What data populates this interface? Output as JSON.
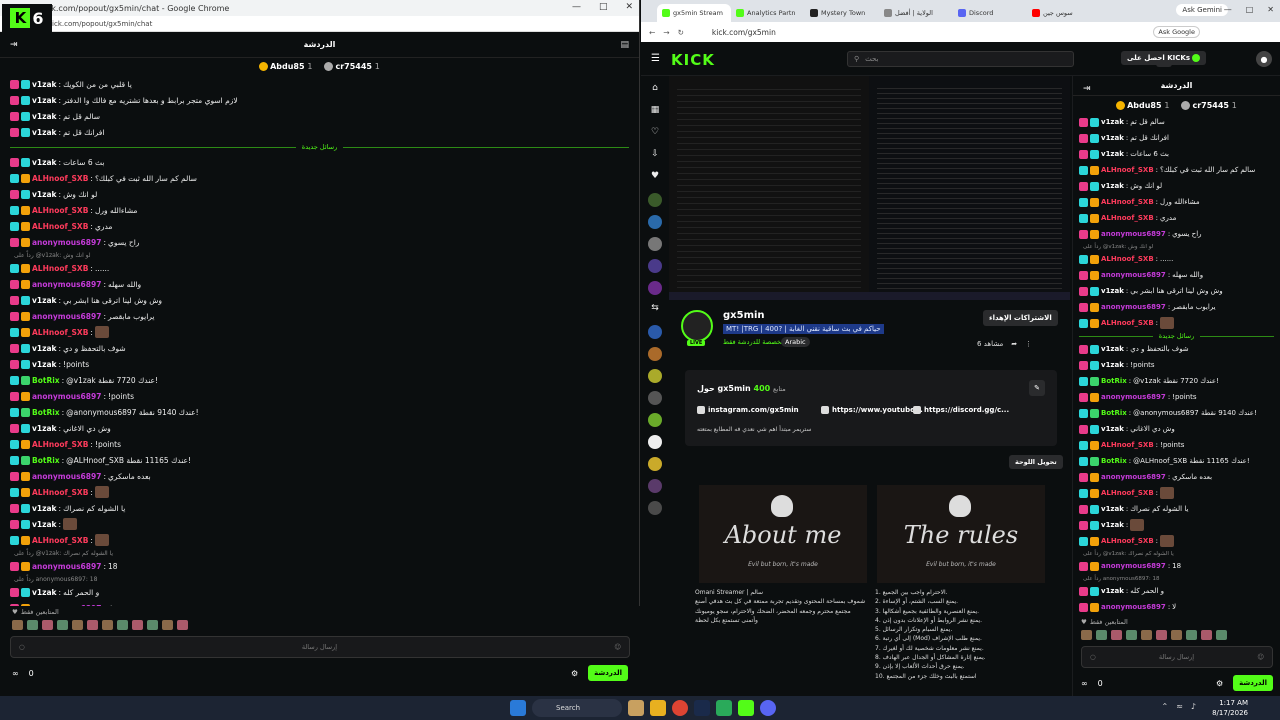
{
  "left_window": {
    "title": "kick.com/popout/gx5min/chat - Google Chrome",
    "address": "kick.com/popout/gx5min/chat",
    "logo_text": "6",
    "chat_title": "الدردشة",
    "gifters": [
      {
        "name": "Abdu85",
        "count": "1"
      },
      {
        "name": "cr75445",
        "count": "1"
      }
    ],
    "separator_label": "رسائل جديدة",
    "messages_before": [
      {
        "user": "v1zak",
        "color": "w",
        "badges": [
          "pk",
          "cy"
        ],
        "text": "يا قلبي من من الكويك"
      },
      {
        "user": "v1zak",
        "color": "w",
        "badges": [
          "pk",
          "cy"
        ],
        "text": "لازم اسوي متجر برابط و بعدها تشتريه مع فالك وا الدفتر"
      },
      {
        "user": "v1zak",
        "color": "w",
        "badges": [
          "pk",
          "cy"
        ],
        "text": "سالم قل تم"
      },
      {
        "user": "v1zak",
        "color": "w",
        "badges": [
          "pk",
          "cy"
        ],
        "text": "افرانك قل تم"
      }
    ],
    "messages_after": [
      {
        "user": "v1zak",
        "color": "w",
        "badges": [
          "pk",
          "cy"
        ],
        "text": "بث 6 ساعات"
      },
      {
        "user": "ALHnoof_SXB",
        "color": "r",
        "badges": [
          "cy",
          "gd"
        ],
        "text": "سالم كم سار الله ثبت في كبلك؟"
      },
      {
        "user": "v1zak",
        "color": "w",
        "badges": [
          "pk",
          "cy"
        ],
        "text": "لو انك وش"
      },
      {
        "user": "ALHnoof_SXB",
        "color": "r",
        "badges": [
          "cy",
          "gd"
        ],
        "text": "مشاءالله ورل"
      },
      {
        "user": "ALHnoof_SXB",
        "color": "r",
        "badges": [
          "cy",
          "gd"
        ],
        "text": "مدري"
      },
      {
        "user": "anonymous6897",
        "color": "m",
        "badges": [
          "pk",
          "gd"
        ],
        "text": "راح يسوي"
      },
      {
        "reply": "رداً على @v1zak: لو انك وش",
        "user": "ALHnoof_SXB",
        "color": "r",
        "badges": [
          "cy",
          "gd"
        ],
        "text": "......"
      },
      {
        "user": "anonymous6897",
        "color": "m",
        "badges": [
          "pk",
          "gd"
        ],
        "text": "والله سهله"
      },
      {
        "user": "v1zak",
        "color": "w",
        "badges": [
          "pk",
          "cy"
        ],
        "text": "وش وش لينا اترقى هنا ابشر بي"
      },
      {
        "user": "anonymous6897",
        "color": "m",
        "badges": [
          "pk",
          "gd"
        ],
        "text": "يرايوب مابقصر"
      },
      {
        "user": "ALHnoof_SXB",
        "color": "r",
        "badges": [
          "cy",
          "gd"
        ],
        "text": "",
        "emoji": true
      },
      {
        "user": "v1zak",
        "color": "w",
        "badges": [
          "pk",
          "cy"
        ],
        "text": "شوف بالتحفظ و دي"
      },
      {
        "user": "v1zak",
        "color": "w",
        "badges": [
          "pk",
          "cy"
        ],
        "text": "!points"
      },
      {
        "user": "BotRix",
        "color": "g",
        "badges": [
          "cy",
          "gr"
        ],
        "text": "@v1zak عندك 7720 نقطة!"
      },
      {
        "user": "anonymous6897",
        "color": "m",
        "badges": [
          "pk",
          "gd"
        ],
        "text": "!points"
      },
      {
        "user": "BotRix",
        "color": "g",
        "badges": [
          "cy",
          "gr"
        ],
        "text": "@anonymous6897 عندك 9140 نقطة!"
      },
      {
        "user": "v1zak",
        "color": "w",
        "badges": [
          "pk",
          "cy"
        ],
        "text": "وش دي الاغاني"
      },
      {
        "user": "ALHnoof_SXB",
        "color": "r",
        "badges": [
          "cy",
          "gd"
        ],
        "text": "!points"
      },
      {
        "user": "BotRix",
        "color": "g",
        "badges": [
          "cy",
          "gr"
        ],
        "text": "@ALHnoof_SXB عندك 11165 نقطة!"
      },
      {
        "user": "anonymous6897",
        "color": "m",
        "badges": [
          "pk",
          "gd"
        ],
        "text": "بعده ماسكري"
      },
      {
        "user": "ALHnoof_SXB",
        "color": "r",
        "badges": [
          "cy",
          "gd"
        ],
        "text": "",
        "emoji": true
      },
      {
        "user": "v1zak",
        "color": "w",
        "badges": [
          "pk",
          "cy"
        ],
        "text": "يا الشوله كم نصراك"
      },
      {
        "user": "v1zak",
        "color": "w",
        "badges": [
          "pk",
          "cy"
        ],
        "text": "",
        "emoji": true
      },
      {
        "user": "ALHnoof_SXB",
        "color": "r",
        "badges": [
          "cy",
          "gd"
        ],
        "text": "",
        "emoji": true
      },
      {
        "reply": "رداً على @v1zak: يا الشوله كم نصراك",
        "user": "anonymous6897",
        "color": "m",
        "badges": [
          "pk",
          "gd"
        ],
        "text": "18"
      },
      {
        "reply": "رداً على anonymous6897: 18",
        "user": "v1zak",
        "color": "w",
        "badges": [
          "pk",
          "cy"
        ],
        "text": "و الحمر كله"
      },
      {
        "user": "anonymous6897",
        "color": "m",
        "badges": [
          "pk",
          "gd"
        ],
        "text": "لا"
      }
    ],
    "emotes_label": "المتابعين فقط",
    "chat_placeholder": "إرسال رسالة",
    "viewers": "0",
    "chat_button": "الدردشة"
  },
  "right_window": {
    "tabs": [
      {
        "label": "gx5min Stream",
        "color": "#53fc18",
        "active": true
      },
      {
        "label": "Analytics Partn",
        "color": "#53fc18"
      },
      {
        "label": "Mystery Town",
        "color": "#222"
      },
      {
        "label": "الولاية | أفضل",
        "color": "#888"
      },
      {
        "label": "Discord",
        "color": "#5865f2"
      },
      {
        "label": "سوس جين",
        "color": "#ff0000"
      }
    ],
    "ask_gemini": "Ask Gemini",
    "address": "kick.com/gx5min",
    "ask_google": "Ask Google",
    "kick_logo": "KICK",
    "search_placeholder": "بحث",
    "get_kicks": "احصل على KICKs",
    "channel": {
      "name": "gx5min",
      "title": "MT! |TRG | 400? | حياكم في بث ساقية نقني الغابة",
      "category": "مخصصة للدردشة فقط",
      "language": "Arabic",
      "live": "LIVE",
      "subs_button": "الاشتراكات الإهداء",
      "viewers_count": "6",
      "viewers_label": "مشاهد"
    },
    "about": {
      "heading": "حول gx5min",
      "followers": "400",
      "followers_label": "متابع",
      "links": [
        "instagram.com/gx5min",
        "https://www.youtube...",
        "https://discord.gg/c..."
      ],
      "description": "ستريمر مبتدأ اهم شي نعدي فه المطابع بمتعته"
    },
    "edit_panels": "تحويل اللوحة",
    "panels": [
      {
        "title": "About me",
        "subtitle": "Evil but born, it's made",
        "lines": [
          "Omani Streamer | سالم",
          "شموف بمساحة المحتوى وتقديم تجربة ممتعة في كل بث هدفي أصنع",
          "مجتمع محترم وجمعه المحضر، الضحك والاحترام، سجو يوميونك",
          "وأتمنى تستمتع بكل لحظة"
        ]
      },
      {
        "title": "The rules",
        "subtitle": "Evil but born, it's made",
        "lines": [
          "1. الاحترام واجب بين الجميع.",
          "2. يمنع السب، الشتم، أو الإساءة.",
          "3. يمنع العنصرية والطائفية بجميع أشكالها.",
          "4. يمنع نشر الروابط أو الإعلانات بدون إذن.",
          "5. يمنع السبام وتكرار الرسائل.",
          "6. إلى أي رتبة (Mod) يمنع طلب الإشراف.",
          "7. يمنع نشر معلومات شخصية لك أو لغيرك.",
          "8. يمنع إثارة المشاكل أو الجدال عبر الهادف.",
          "9. يمنع حرق أحداث الألعاب إلا بإذن.",
          "10. استمتع بالبث وخلك جزء من المجتمع"
        ]
      }
    ],
    "chat": {
      "title": "الدردشة",
      "gifters": [
        {
          "name": "Abdu85",
          "count": "1"
        },
        {
          "name": "cr75445",
          "count": "1"
        }
      ],
      "separator_label": "رسائل جديدة",
      "messages_before": [
        {
          "user": "v1zak",
          "color": "w",
          "badges": [
            "pk",
            "cy"
          ],
          "text": "سالم قل تم"
        },
        {
          "user": "v1zak",
          "color": "w",
          "badges": [
            "pk",
            "cy"
          ],
          "text": "افرانك قل تم"
        },
        {
          "user": "v1zak",
          "color": "w",
          "badges": [
            "pk",
            "cy"
          ],
          "text": "بث 6 ساعات"
        },
        {
          "user": "ALHnoof_SXB",
          "color": "r",
          "badges": [
            "cy",
            "gd"
          ],
          "text": "سالم كم سار الله ثبت في كبلك؟"
        },
        {
          "user": "v1zak",
          "color": "w",
          "badges": [
            "pk",
            "cy"
          ],
          "text": "لو انك وش"
        },
        {
          "user": "ALHnoof_SXB",
          "color": "r",
          "badges": [
            "cy",
            "gd"
          ],
          "text": "مشاءالله ورل"
        },
        {
          "user": "ALHnoof_SXB",
          "color": "r",
          "badges": [
            "cy",
            "gd"
          ],
          "text": "مدري"
        },
        {
          "user": "anonymous6897",
          "color": "m",
          "badges": [
            "pk",
            "gd"
          ],
          "text": "راح يسوي"
        },
        {
          "reply": "رداً على @v1zak: لو انك وش",
          "user": "ALHnoof_SXB",
          "color": "r",
          "badges": [
            "cy",
            "gd"
          ],
          "text": "......"
        },
        {
          "user": "anonymous6897",
          "color": "m",
          "badges": [
            "pk",
            "gd"
          ],
          "text": "والله سهله"
        },
        {
          "user": "v1zak",
          "color": "w",
          "badges": [
            "pk",
            "cy"
          ],
          "text": "وش وش لينا اترقى هنا ابشر بي"
        },
        {
          "user": "anonymous6897",
          "color": "m",
          "badges": [
            "pk",
            "gd"
          ],
          "text": "يرايوب مابقصر"
        },
        {
          "user": "ALHnoof_SXB",
          "color": "r",
          "badges": [
            "cy",
            "gd"
          ],
          "text": "",
          "emoji": true
        }
      ],
      "messages_after": [
        {
          "user": "v1zak",
          "color": "w",
          "badges": [
            "pk",
            "cy"
          ],
          "text": "شوف بالتحفظ و دي"
        },
        {
          "user": "v1zak",
          "color": "w",
          "badges": [
            "pk",
            "cy"
          ],
          "text": "!points"
        },
        {
          "user": "BotRix",
          "color": "g",
          "badges": [
            "cy",
            "gr"
          ],
          "text": "@v1zak عندك 7720 نقطة!"
        },
        {
          "user": "anonymous6897",
          "color": "m",
          "badges": [
            "pk",
            "gd"
          ],
          "text": "!points"
        },
        {
          "user": "BotRix",
          "color": "g",
          "badges": [
            "cy",
            "gr"
          ],
          "text": "@anonymous6897 عندك 9140 نقطة!"
        },
        {
          "user": "v1zak",
          "color": "w",
          "badges": [
            "pk",
            "cy"
          ],
          "text": "وش دي الاغاني"
        },
        {
          "user": "ALHnoof_SXB",
          "color": "r",
          "badges": [
            "cy",
            "gd"
          ],
          "text": "!points"
        },
        {
          "user": "BotRix",
          "color": "g",
          "badges": [
            "cy",
            "gr"
          ],
          "text": "@ALHnoof_SXB عندك 11165 نقطة!"
        },
        {
          "user": "anonymous6897",
          "color": "m",
          "badges": [
            "pk",
            "gd"
          ],
          "text": "بعده ماسكري"
        },
        {
          "user": "ALHnoof_SXB",
          "color": "r",
          "badges": [
            "cy",
            "gd"
          ],
          "text": "",
          "emoji": true
        },
        {
          "user": "v1zak",
          "color": "w",
          "badges": [
            "pk",
            "cy"
          ],
          "text": "يا الشوله كم نصراك"
        },
        {
          "user": "v1zak",
          "color": "w",
          "badges": [
            "pk",
            "cy"
          ],
          "text": "",
          "emoji": true
        },
        {
          "user": "ALHnoof_SXB",
          "color": "r",
          "badges": [
            "cy",
            "gd"
          ],
          "text": "",
          "emoji": true
        },
        {
          "reply": "رداً على @v1zak: يا الشوله كم نصراك",
          "user": "anonymous6897",
          "color": "m",
          "badges": [
            "pk",
            "gd"
          ],
          "text": "18"
        },
        {
          "reply": "رداً على anonymous6897: 18",
          "user": "v1zak",
          "color": "w",
          "badges": [
            "pk",
            "cy"
          ],
          "text": "و الحمر كله"
        },
        {
          "user": "anonymous6897",
          "color": "m",
          "badges": [
            "pk",
            "gd"
          ],
          "text": "لا"
        }
      ],
      "emotes_label": "المتابعين فقط",
      "chat_placeholder": "إرسال رسالة",
      "viewers": "0",
      "chat_button": "الدردشة"
    }
  },
  "taskbar": {
    "search_label": "Search",
    "time": "1:17 AM",
    "date": "8/17/2026"
  },
  "colors": {
    "accent": "#53fc18",
    "background": "#0b0e0f"
  }
}
